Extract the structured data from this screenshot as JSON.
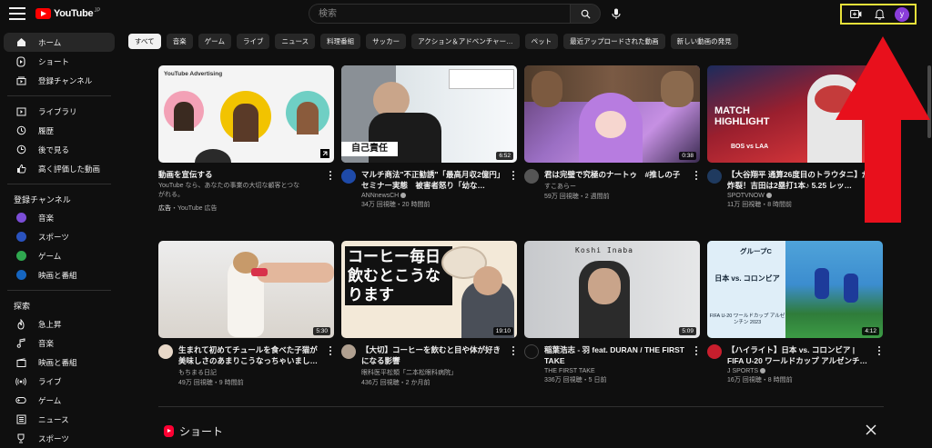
{
  "header": {
    "logo_text": "YouTube",
    "logo_region": "JP",
    "search_placeholder": "検索",
    "avatar_initial": "ｙ"
  },
  "sidebar": {
    "main": [
      {
        "label": "ホーム",
        "icon": "home-icon",
        "active": true
      },
      {
        "label": "ショート",
        "icon": "shorts-icon"
      },
      {
        "label": "登録チャンネル",
        "icon": "subscriptions-icon"
      }
    ],
    "library": [
      {
        "label": "ライブラリ",
        "icon": "library-icon"
      },
      {
        "label": "履歴",
        "icon": "history-icon"
      },
      {
        "label": "後で見る",
        "icon": "watch-later-icon"
      },
      {
        "label": "高く評価した動画",
        "icon": "thumbs-up-icon"
      }
    ],
    "subscriptions_heading": "登録チャンネル",
    "subscriptions": [
      {
        "label": "音楽",
        "color": "#7b4dd6"
      },
      {
        "label": "スポーツ",
        "color": "#2a52be"
      },
      {
        "label": "ゲーム",
        "color": "#2fa84f"
      },
      {
        "label": "映画と番組",
        "color": "#1565c0"
      }
    ],
    "explore_heading": "探索",
    "explore": [
      {
        "label": "急上昇",
        "icon": "trending-icon"
      },
      {
        "label": "音楽",
        "icon": "music-icon"
      },
      {
        "label": "映画と番組",
        "icon": "movie-icon"
      },
      {
        "label": "ライブ",
        "icon": "live-icon"
      },
      {
        "label": "ゲーム",
        "icon": "gaming-icon"
      },
      {
        "label": "ニュース",
        "icon": "news-icon"
      },
      {
        "label": "スポーツ",
        "icon": "sports-icon"
      }
    ]
  },
  "chips": [
    "すべて",
    "音楽",
    "ゲーム",
    "ライブ",
    "ニュース",
    "料理番組",
    "サッカー",
    "アクション＆アドベンチャー…",
    "ペット",
    "最近アップロードされた動画",
    "新しい動画の発見"
  ],
  "videos": [
    {
      "title": "動画を宣伝する",
      "channel": "",
      "stats": "",
      "desc": "YouTube なら、あなたの事業の大切な顧客とつながれる。",
      "ad_label": "広告",
      "ad_source": "・YouTube 広告",
      "duration": "",
      "avatar_color": "#ffffff",
      "thumb_text": "YouTube Advertising"
    },
    {
      "title": "マルチ商法\"不正勧誘\"「最高月収2億円」セミナー実態　被害者怒り「幼な…",
      "channel": "ANNnewsCH",
      "stats": "34万 回視聴・20 時間前",
      "duration": "6:52",
      "avatar_color": "#1e4aa8",
      "thumb_text": "自己責任"
    },
    {
      "title": "君は完璧で究極のナートゥ　#推しの子",
      "channel": "すこあらー",
      "stats": "59万 回視聴・2 週間前",
      "duration": "0:38",
      "avatar_color": "#555555",
      "thumb_text": ""
    },
    {
      "title": "【大谷翔平 通算26度目のトラウタニ】が炸裂！吉田は2塁打1本♪ 5.25 レッ…",
      "channel": "SPOTVNOW",
      "stats": "11万 回視聴・8 時間前",
      "duration": "",
      "avatar_color": "#1f3a5f",
      "thumb_text": "MATCH HIGHLIGHT",
      "thumb_sub": "BOS vs LAA"
    },
    {
      "title": "生まれて初めてチュールを食べた子猫が美味しさのあまりこうなっちゃいまし…",
      "channel": "もちまる日記",
      "stats": "49万 回視聴・9 時間前",
      "duration": "5:30",
      "avatar_color": "#e8d8c8",
      "thumb_text": ""
    },
    {
      "title": "【大切】コーヒーを飲むと目や体が好きになる影響",
      "channel": "眼科医平松類「二本松眼科病院」",
      "stats": "436万 回視聴・2 か月前",
      "duration": "19:10",
      "avatar_color": "#b0a090",
      "thumb_text": "コーヒー毎日飲むとこうなります"
    },
    {
      "title": "稲葉浩志 - 羽 feat. DURAN / THE FIRST TAKE",
      "channel": "THE FIRST TAKE",
      "stats": "336万 回視聴・5 日前",
      "duration": "5:09",
      "avatar_color": "#111111",
      "thumb_text": "Koshi Inaba"
    },
    {
      "title": "【ハイライト】日本 vs. コロンビア | FIFA U-20 ワールドカップ アルゼンチ…",
      "channel": "J SPORTS",
      "stats": "16万 回視聴・8 時間前",
      "duration": "4:12",
      "avatar_color": "#c81e2d",
      "thumb_text": "グループC",
      "thumb_sub": "日本 vs. コロンビア",
      "thumb_sub2": "FIFA U-20 ワールドカップ アルゼンチン 2023"
    }
  ],
  "shorts": {
    "title": "ショート"
  },
  "colors": {
    "accent": "#ff0000",
    "highlight_box": "#e8e13a",
    "annotation_arrow": "#e8101c"
  }
}
